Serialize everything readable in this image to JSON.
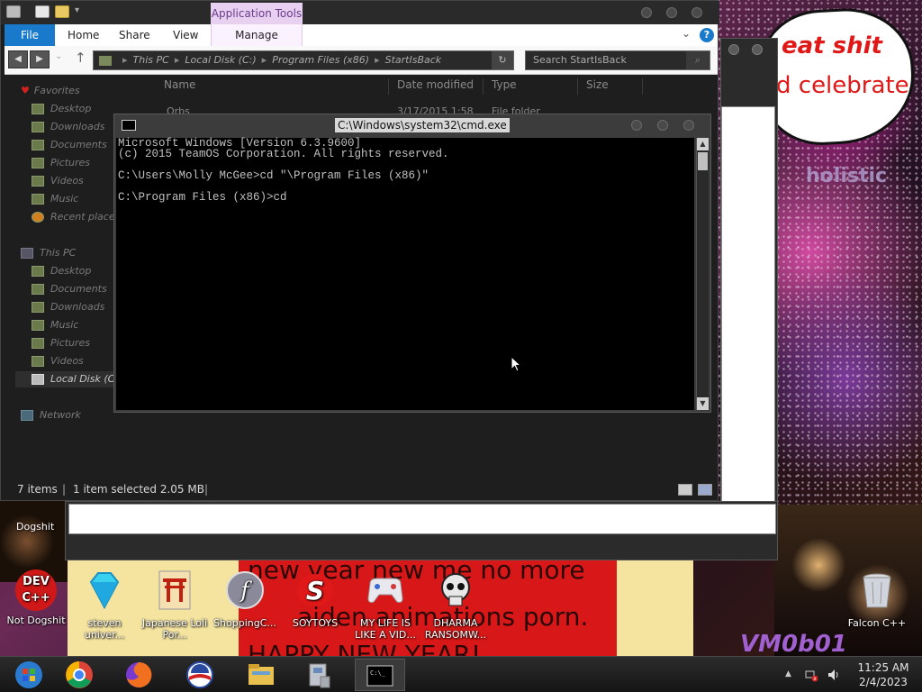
{
  "explorer": {
    "ribbon_context": "Application Tools",
    "tabs": [
      "File",
      "Home",
      "Share",
      "View",
      "Manage"
    ],
    "address": [
      "This PC",
      "Local Disk (C:)",
      "Program Files (x86)",
      "StartIsBack"
    ],
    "search_placeholder": "Search StartIsBack",
    "columns": [
      "Name",
      "Date modified",
      "Type",
      "Size"
    ],
    "partial_row": {
      "name": "Orbs",
      "date": "3/17/2015 1:58",
      "type": "File folder"
    },
    "sidebar": {
      "favorites_title": "Favorites",
      "favorites": [
        "Desktop",
        "Downloads",
        "Documents",
        "Pictures",
        "Videos",
        "Music",
        "Recent places"
      ],
      "thispc_title": "This PC",
      "thispc": [
        "Desktop",
        "Documents",
        "Downloads",
        "Music",
        "Pictures",
        "Videos",
        "Local Disk (C:)"
      ],
      "network": "Network"
    },
    "status": {
      "items": "7 items",
      "selected": "1 item selected  2.05 MB"
    }
  },
  "cmd": {
    "title": "C:\\Windows\\system32\\cmd.exe",
    "lines": [
      "Microsoft Windows [Version 6.3.9600]",
      "(c) 2015 TeamOS Corporation. All rights reserved.",
      "",
      "C:\\Users\\Molly McGee>cd \"\\Program Files (x86)\"",
      "",
      "C:\\Program Files (x86)>cd"
    ]
  },
  "wallpaper": {
    "bubble_line1": "eat shit",
    "bubble_line2": "d celebrate",
    "word": "holistic",
    "banner_line1": "new year new me no more",
    "banner_line2": "aiden animations porn.",
    "banner_line3": "HAPPY NEW YEAR!",
    "signature": "VM0b01"
  },
  "desktop_icons": [
    {
      "label": "Not Dogshit",
      "icon": "dev-cpp-icon"
    },
    {
      "label": "steven univer...",
      "icon": "diamond-icon"
    },
    {
      "label": "Japanese Loli Por...",
      "icon": "torii-icon"
    },
    {
      "label": "ShoppingC...",
      "icon": "flash-icon"
    },
    {
      "label": "SOYTOYS",
      "icon": "s-logo-icon"
    },
    {
      "label": "MY LIFE IS LIKE A VID...",
      "icon": "gamepad-icon"
    },
    {
      "label": "DHARMA RANSOMW...",
      "icon": "skull-icon"
    },
    {
      "label": "Falcon C++",
      "icon": "recycle-bin-icon"
    }
  ],
  "dogshit_label": "Dogshit",
  "taskbar": {
    "apps": [
      "start-orb-icon",
      "chrome-icon",
      "firefox-icon",
      "obama-logo-icon",
      "file-explorer-icon",
      "control-panel-icon",
      "cmd-icon"
    ],
    "time": "11:25 AM",
    "date": "2/4/2023"
  },
  "colors": {
    "file_tab": "#1979ca",
    "app_tools": "#e8d0f0",
    "banner_red": "#d81818"
  }
}
